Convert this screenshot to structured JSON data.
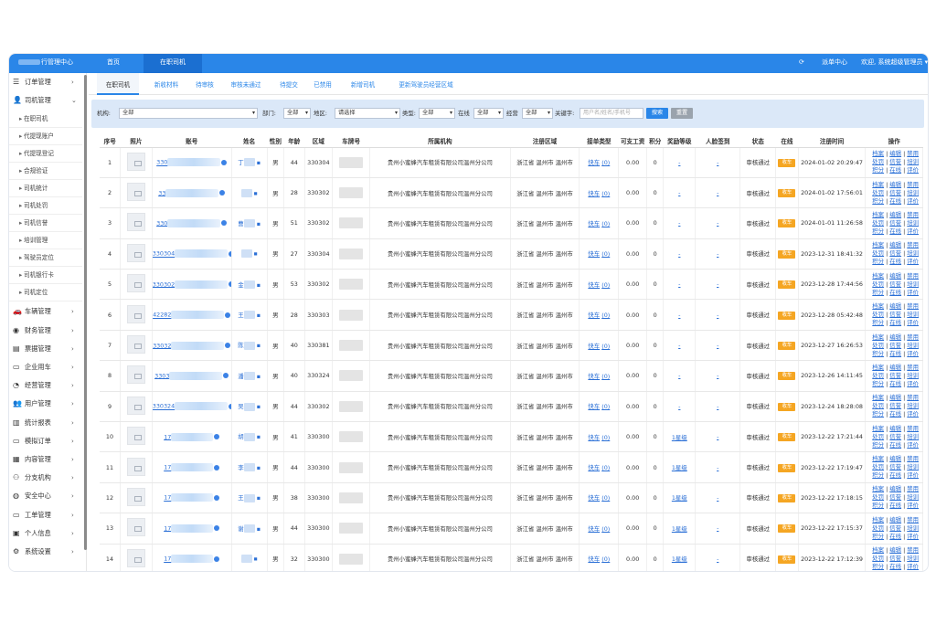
{
  "topbar": {
    "brand": "行管理中心",
    "tabs": [
      "首页",
      "在职司机"
    ],
    "refresh_icon": "refresh-icon",
    "dispatch": "派单中心",
    "welcome": "欢迎, 系统超级管理员"
  },
  "sidebar": {
    "groups": [
      {
        "label": "订单管理",
        "icon": "list-icon"
      },
      {
        "label": "司机管理",
        "icon": "user-icon"
      }
    ],
    "subitems": [
      "在职司机",
      "代提现账户",
      "代提现登记",
      "合规验证",
      "司机统计",
      "司机处罚",
      "司机信誉",
      "培训管理",
      "驾驶员定位",
      "司机银行卡",
      "司机定位"
    ],
    "groups2": [
      {
        "label": "车辆管理",
        "icon": "car-icon"
      },
      {
        "label": "财务管理",
        "icon": "finance-icon"
      },
      {
        "label": "票据管理",
        "icon": "ticket-icon"
      },
      {
        "label": "企业用车",
        "icon": "desktop-icon"
      },
      {
        "label": "经营管理",
        "icon": "pie-chart-icon"
      },
      {
        "label": "用户管理",
        "icon": "users-icon"
      },
      {
        "label": "统计报表",
        "icon": "bar-chart-icon"
      },
      {
        "label": "模拟订单",
        "icon": "monitor-icon"
      },
      {
        "label": "内容管理",
        "icon": "grid-icon"
      },
      {
        "label": "分支机构",
        "icon": "sitemap-icon"
      },
      {
        "label": "安全中心",
        "icon": "globe-icon"
      },
      {
        "label": "工单管理",
        "icon": "desktop-icon"
      },
      {
        "label": "个人信息",
        "icon": "id-card-icon"
      },
      {
        "label": "系统设置",
        "icon": "gear-icon"
      }
    ]
  },
  "subtabs": [
    "在职司机",
    "新收材料",
    "待审核",
    "审核未通过",
    "待提交",
    "已禁用",
    "新增司机",
    "更新驾驶员经营区域"
  ],
  "filter": {
    "org_label": "机构:",
    "org_value": "全部",
    "dept_label": "部门:",
    "dept_value": "全部",
    "area_label": "地区:",
    "area_value": "请选择",
    "type_label": "类型:",
    "type_value": "全部",
    "online_label": "在线",
    "online_value": "全部",
    "biz_label": "经营",
    "biz_value": "全部",
    "kw_label": "关键字:",
    "kw_placeholder": "用户名/姓名/手机号",
    "search": "搜索",
    "reset": "重置"
  },
  "table": {
    "headers": [
      "序号",
      "照片",
      "账号",
      "姓名",
      "性别",
      "年龄",
      "区域",
      "车牌号",
      "所属机构",
      "注册区域",
      "接单类型",
      "可支工资",
      "积分",
      "奖励等级",
      "人脸签到",
      "状态",
      "在线",
      "注册时间",
      "操作"
    ],
    "rows": [
      {
        "no": "1",
        "acct": "330",
        "name": "丁",
        "gender": "男",
        "age": "44",
        "area": "330304",
        "org": "贵州小蜜蜂汽车租赁有限公司温州分公司",
        "reg": "浙江省 温州市 温州市",
        "otype": "快车",
        "ocount": "(0)",
        "wage": "0.00",
        "points": "0",
        "level": "-",
        "face": "-",
        "status": "审核通过",
        "online": "收车",
        "time": "2024-01-02 20:29:47"
      },
      {
        "no": "2",
        "acct": "33",
        "name": "",
        "gender": "男",
        "age": "28",
        "area": "330302",
        "org": "贵州小蜜蜂汽车租赁有限公司温州分公司",
        "reg": "浙江省 温州市 温州市",
        "otype": "快车",
        "ocount": "(0)",
        "wage": "0.00",
        "points": "0",
        "level": "-",
        "face": "-",
        "status": "审核通过",
        "online": "收车",
        "time": "2024-01-02 17:56:01"
      },
      {
        "no": "3",
        "acct": "330",
        "name": "曹",
        "gender": "男",
        "age": "51",
        "area": "330302",
        "org": "贵州小蜜蜂汽车租赁有限公司温州分公司",
        "reg": "浙江省 温州市 温州市",
        "otype": "快车",
        "ocount": "(0)",
        "wage": "0.00",
        "points": "0",
        "level": "-",
        "face": "-",
        "status": "审核通过",
        "online": "收车",
        "time": "2024-01-01 11:26:58"
      },
      {
        "no": "4",
        "acct": "330304",
        "name": "",
        "gender": "男",
        "age": "27",
        "area": "330304",
        "org": "贵州小蜜蜂汽车租赁有限公司温州分公司",
        "reg": "浙江省 温州市 温州市",
        "otype": "快车",
        "ocount": "(0)",
        "wage": "0.00",
        "points": "0",
        "level": "-",
        "face": "-",
        "status": "审核通过",
        "online": "收车",
        "time": "2023-12-31 18:41:32"
      },
      {
        "no": "5",
        "acct": "330302",
        "name": "金",
        "gender": "男",
        "age": "53",
        "area": "330302",
        "org": "贵州小蜜蜂汽车租赁有限公司温州分公司",
        "reg": "浙江省 温州市 温州市",
        "otype": "快车",
        "ocount": "(0)",
        "wage": "0.00",
        "points": "0",
        "level": "-",
        "face": "-",
        "status": "审核通过",
        "online": "收车",
        "time": "2023-12-28 17:44:56"
      },
      {
        "no": "6",
        "acct": "42282",
        "name": "王",
        "gender": "男",
        "age": "28",
        "area": "330303",
        "org": "贵州小蜜蜂汽车租赁有限公司温州分公司",
        "reg": "浙江省 温州市 温州市",
        "otype": "快车",
        "ocount": "(0)",
        "wage": "0.00",
        "points": "0",
        "level": "-",
        "face": "-",
        "status": "审核通过",
        "online": "收车",
        "time": "2023-12-28 05:42:48"
      },
      {
        "no": "7",
        "acct": "33032",
        "name": "陈",
        "gender": "男",
        "age": "40",
        "area": "330381",
        "org": "贵州小蜜蜂汽车租赁有限公司温州分公司",
        "reg": "浙江省 温州市 温州市",
        "otype": "快车",
        "ocount": "(0)",
        "wage": "0.00",
        "points": "0",
        "level": "-",
        "face": "-",
        "status": "审核通过",
        "online": "收车",
        "time": "2023-12-27 16:26:53"
      },
      {
        "no": "8",
        "acct": "3303",
        "name": "潘",
        "gender": "男",
        "age": "40",
        "area": "330324",
        "org": "贵州小蜜蜂汽车租赁有限公司温州分公司",
        "reg": "浙江省 温州市 温州市",
        "otype": "快车",
        "ocount": "(0)",
        "wage": "0.00",
        "points": "0",
        "level": "-",
        "face": "-",
        "status": "审核通过",
        "online": "收车",
        "time": "2023-12-26 14:11:45"
      },
      {
        "no": "9",
        "acct": "330324",
        "name": "吴",
        "gender": "男",
        "age": "44",
        "area": "330302",
        "org": "贵州小蜜蜂汽车租赁有限公司温州分公司",
        "reg": "浙江省 温州市 温州市",
        "otype": "快车",
        "ocount": "(0)",
        "wage": "0.00",
        "points": "0",
        "level": "-",
        "face": "-",
        "status": "审核通过",
        "online": "收车",
        "time": "2023-12-24 18:28:08"
      },
      {
        "no": "10",
        "acct": "17",
        "name": "胡",
        "gender": "男",
        "age": "41",
        "area": "330300",
        "org": "贵州小蜜蜂汽车租赁有限公司温州分公司",
        "reg": "浙江省 温州市 温州市",
        "otype": "快车",
        "ocount": "(0)",
        "wage": "0.00",
        "points": "0",
        "level": "1星级",
        "face": "-",
        "status": "审核通过",
        "online": "收车",
        "time": "2023-12-22 17:21:44"
      },
      {
        "no": "11",
        "acct": "17",
        "name": "李",
        "gender": "男",
        "age": "44",
        "area": "330300",
        "org": "贵州小蜜蜂汽车租赁有限公司温州分公司",
        "reg": "浙江省 温州市 温州市",
        "otype": "快车",
        "ocount": "(0)",
        "wage": "0.00",
        "points": "0",
        "level": "1星级",
        "face": "-",
        "status": "审核通过",
        "online": "收车",
        "time": "2023-12-22 17:19:47"
      },
      {
        "no": "12",
        "acct": "17",
        "name": "王",
        "gender": "男",
        "age": "38",
        "area": "330300",
        "org": "贵州小蜜蜂汽车租赁有限公司温州分公司",
        "reg": "浙江省 温州市 温州市",
        "otype": "快车",
        "ocount": "(0)",
        "wage": "0.00",
        "points": "0",
        "level": "1星级",
        "face": "-",
        "status": "审核通过",
        "online": "收车",
        "time": "2023-12-22 17:18:15"
      },
      {
        "no": "13",
        "acct": "17",
        "name": "谢",
        "gender": "男",
        "age": "44",
        "area": "330300",
        "org": "贵州小蜜蜂汽车租赁有限公司温州分公司",
        "reg": "浙江省 温州市 温州市",
        "otype": "快车",
        "ocount": "(0)",
        "wage": "0.00",
        "points": "0",
        "level": "1星级",
        "face": "-",
        "status": "审核通过",
        "online": "收车",
        "time": "2023-12-22 17:15:37"
      },
      {
        "no": "14",
        "acct": "17",
        "name": "",
        "gender": "男",
        "age": "32",
        "area": "330300",
        "org": "贵州小蜜蜂汽车租赁有限公司温州分公司",
        "reg": "浙江省 温州市 温州市",
        "otype": "快车",
        "ocount": "(0)",
        "wage": "0.00",
        "points": "0",
        "level": "1星级",
        "face": "-",
        "status": "审核通过",
        "online": "收车",
        "time": "2023-12-22 17:12:39"
      }
    ],
    "ops": [
      "档案",
      "编辑",
      "禁用",
      "处罚",
      "信誉",
      "培训",
      "积分",
      "在线",
      "评价"
    ]
  },
  "colors": {
    "primary": "#2a86e8",
    "badge": "#f5a623",
    "link": "#2a6fd6"
  }
}
